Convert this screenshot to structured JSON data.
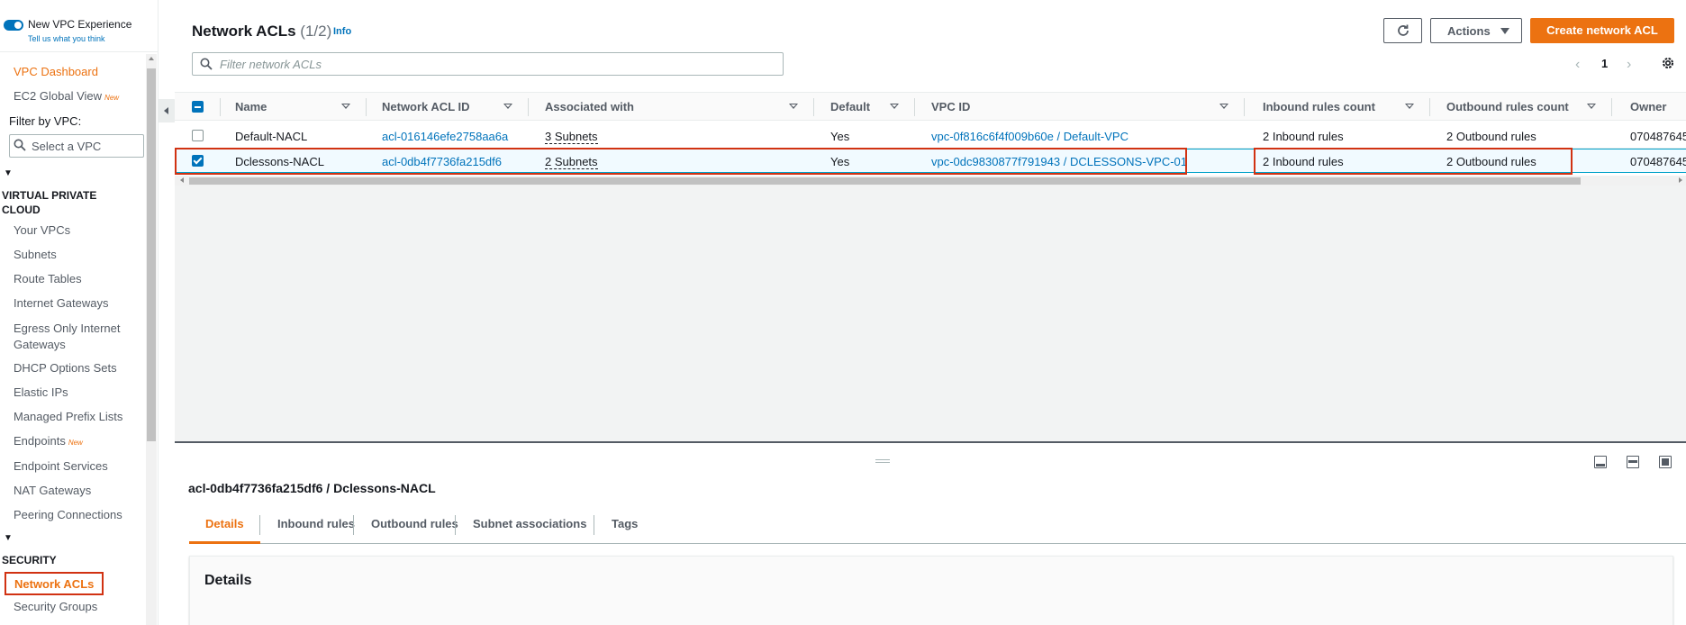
{
  "sidebar": {
    "toggle_label": "New VPC Experience",
    "toggle_sub": "Tell us what you think",
    "dashboard": "VPC Dashboard",
    "ec2_global": "EC2 Global View",
    "new_badge": "New",
    "filter_label": "Filter by VPC:",
    "select_placeholder": "Select a VPC",
    "section_vpc": "VIRTUAL PRIVATE CLOUD",
    "vpc_items": [
      "Your VPCs",
      "Subnets",
      "Route Tables",
      "Internet Gateways",
      "Egress Only Internet Gateways",
      "DHCP Options Sets",
      "Elastic IPs",
      "Managed Prefix Lists",
      "Endpoints",
      "Endpoint Services",
      "NAT Gateways",
      "Peering Connections"
    ],
    "section_security": "SECURITY",
    "active_item": "Network ACLs",
    "security_groups": "Security Groups"
  },
  "header": {
    "title": "Network ACLs",
    "count": "(1/2)",
    "info": "Info",
    "actions_label": "Actions",
    "create_label": "Create network ACL",
    "filter_placeholder": "Filter network ACLs",
    "page": "1"
  },
  "table": {
    "columns": [
      "Name",
      "Network ACL ID",
      "Associated with",
      "Default",
      "VPC ID",
      "Inbound rules count",
      "Outbound rules count",
      "Owner"
    ],
    "rows": [
      {
        "name": "Default-NACL",
        "id": "acl-016146efe2758aa6a",
        "assoc": "3 Subnets",
        "default": "Yes",
        "vpc": "vpc-0f816c6f4f009b60e / Default-VPC",
        "inbound": "2 Inbound rules",
        "outbound": "2 Outbound rules",
        "owner": "070487645"
      },
      {
        "name": "Dclessons-NACL",
        "id": "acl-0db4f7736fa215df6",
        "assoc": "2 Subnets",
        "default": "Yes",
        "vpc": "vpc-0dc9830877f791943 / DCLESSONS-VPC-01",
        "inbound": "2 Inbound rules",
        "outbound": "2 Outbound rules",
        "owner": "070487645"
      }
    ]
  },
  "panel": {
    "title": "acl-0db4f7736fa215df6 / Dclessons-NACL",
    "tabs": [
      "Details",
      "Inbound rules",
      "Outbound rules",
      "Subnet associations",
      "Tags"
    ],
    "details_heading": "Details"
  },
  "colors": {
    "accent": "#ec7211",
    "link": "#0073bb",
    "highlight": "#d13212"
  }
}
